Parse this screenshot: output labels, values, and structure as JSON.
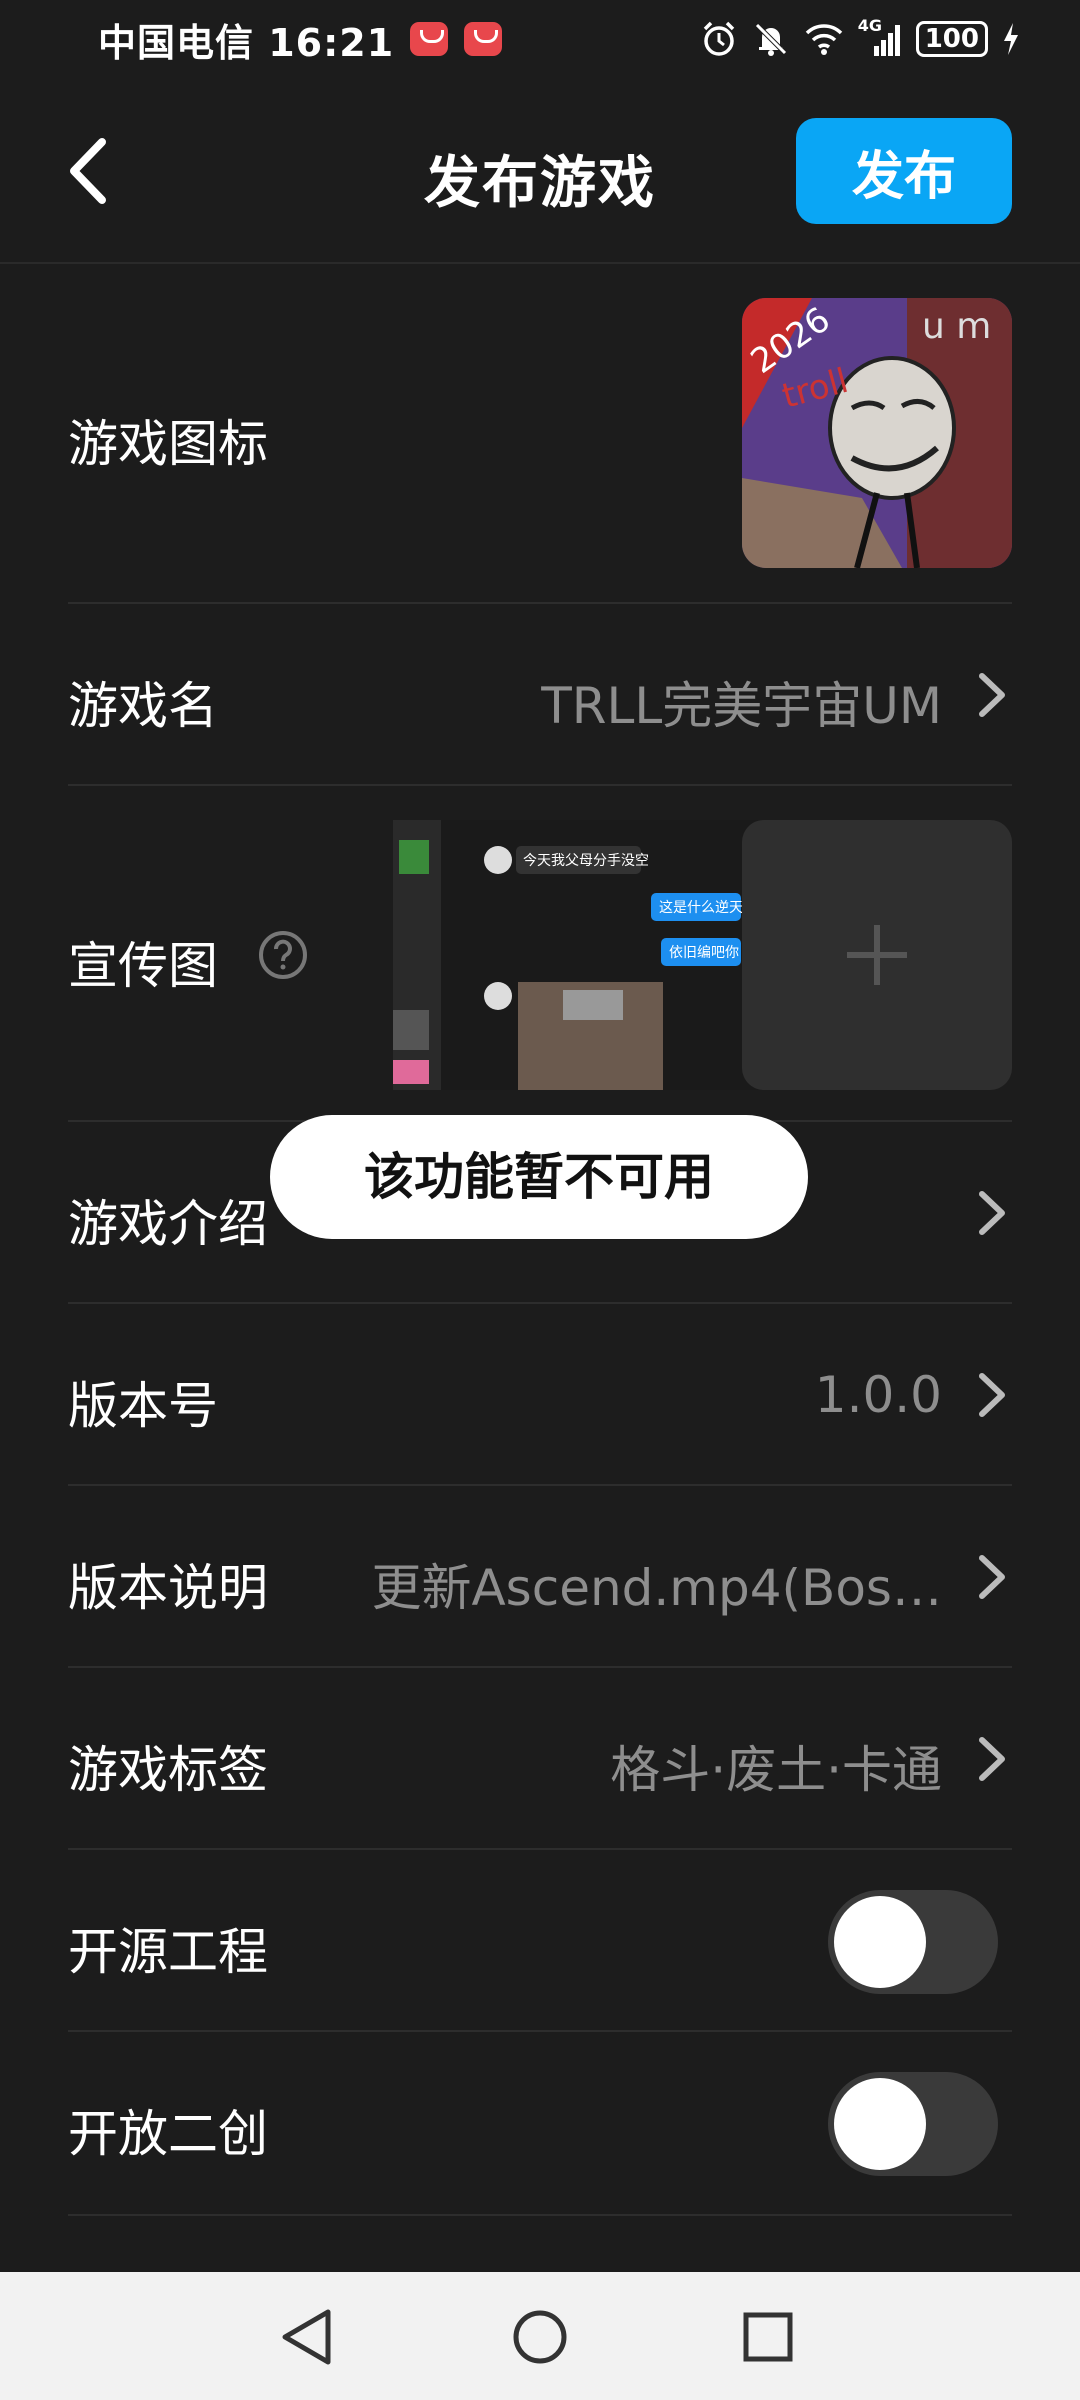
{
  "status_bar": {
    "carrier_time": "中国电信 16:21",
    "signal_label": "4G",
    "battery": "100"
  },
  "header": {
    "title": "发布游戏",
    "publish_label": "发布"
  },
  "rows": {
    "icon": {
      "label": "游戏图标"
    },
    "name": {
      "label": "游戏名",
      "value": "TRLL完美宇宙UM"
    },
    "promo": {
      "label": "宣传图"
    },
    "intro": {
      "label": "游戏介绍"
    },
    "version": {
      "label": "版本号",
      "value": "1.0.0"
    },
    "version_notes": {
      "label": "版本说明",
      "value": "更新Ascend.mp4(Bos…"
    },
    "tags": {
      "label": "游戏标签",
      "value": "格斗·废土·卡通"
    },
    "open_source": {
      "label": "开源工程",
      "enabled": false
    },
    "open_derivative": {
      "label": "开放二创",
      "enabled": false
    }
  },
  "promo_screenshot": {
    "msg1": "今天我父母分手没空",
    "msg2": "这是什么逆天",
    "msg3": "依旧编吧你"
  },
  "toast": {
    "text": "该功能暂不可用"
  },
  "colors": {
    "accent": "#0aa6f5",
    "background": "#1c1c1c"
  }
}
